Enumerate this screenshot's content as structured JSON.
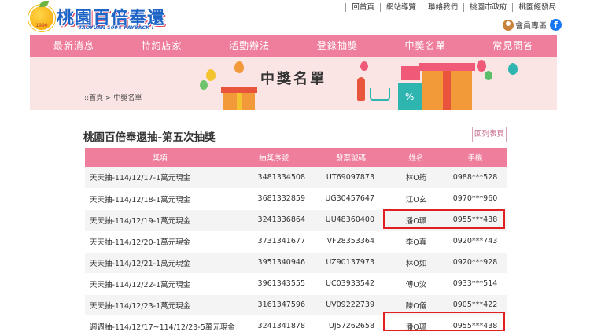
{
  "header": {
    "logo_title": "桃園百倍奉還",
    "logo_sub": "TAOYUAN 100× PAYBACK !",
    "logo_badge": "1990",
    "top_links": [
      "回首頁",
      "網站導覽",
      "聯絡我們",
      "桃園市政府",
      "桃園經發局"
    ],
    "member_label": "會員專區",
    "fb_label": "f"
  },
  "nav": {
    "items": [
      "最新消息",
      "特約店家",
      "活動辦法",
      "登錄抽獎",
      "中獎名單",
      "常見問答"
    ]
  },
  "banner": {
    "title": "中獎名單",
    "breadcrumb": ":::首頁 > 中獎名單"
  },
  "main": {
    "section_title": "桃園百倍奉還抽-第五次抽獎",
    "back_button": "回列表頁",
    "columns": [
      "獎項",
      "抽獎序號",
      "發票號碼",
      "姓名",
      "手機"
    ],
    "rows": [
      {
        "item": "天天抽-114/12/17-1萬元現金",
        "serial": "3481334508",
        "invoice": "UT69097873",
        "name": "林O筠",
        "phone": "0988***528"
      },
      {
        "item": "天天抽-114/12/18-1萬元現金",
        "serial": "3681332859",
        "invoice": "UG30457647",
        "name": "江O玄",
        "phone": "0970***960"
      },
      {
        "item": "天天抽-114/12/19-1萬元現金",
        "serial": "3241336864",
        "invoice": "UU48360400",
        "name": "潘O珮",
        "phone": "0955***438"
      },
      {
        "item": "天天抽-114/12/20-1萬元現金",
        "serial": "3731341677",
        "invoice": "VF28353364",
        "name": "李O真",
        "phone": "0920***743"
      },
      {
        "item": "天天抽-114/12/21-1萬元現金",
        "serial": "3951340946",
        "invoice": "UZ90137973",
        "name": "林O如",
        "phone": "0920***928"
      },
      {
        "item": "天天抽-114/12/22-1萬元現金",
        "serial": "3961343555",
        "invoice": "UC03933542",
        "name": "傅O汶",
        "phone": "0933***514"
      },
      {
        "item": "天天抽-114/12/23-1萬元現金",
        "serial": "3161347596",
        "invoice": "UV09222739",
        "name": "陳O儀",
        "phone": "0905***422"
      },
      {
        "item": "週週抽-114/12/17~114/12/23-5萬元現金",
        "serial": "3241341878",
        "invoice": "UJ57262658",
        "name": "潘O珮",
        "phone": "0955***438"
      }
    ]
  },
  "colors": {
    "accent_pink": "#ee7e9b",
    "banner_bg": "#fbe4e4",
    "highlight_red": "#e02020",
    "logo_blue": "#1e63c6"
  }
}
